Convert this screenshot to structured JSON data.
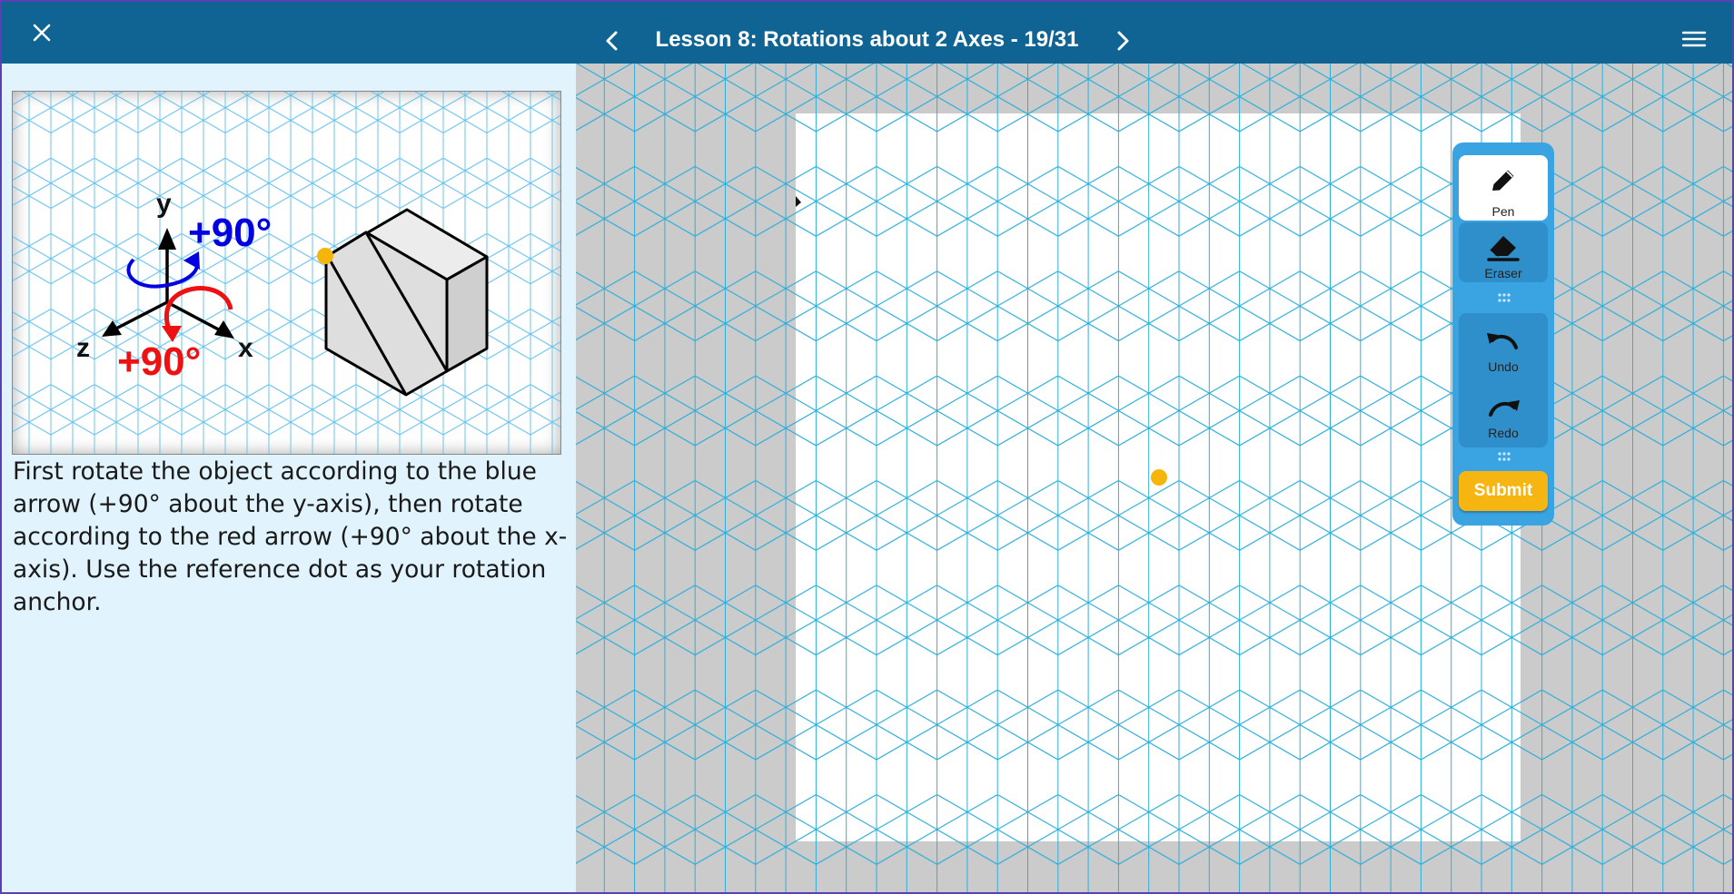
{
  "header": {
    "title": "Lesson 8: Rotations about 2 Axes - 19/31",
    "close_icon": "close-icon",
    "prev_icon": "chevron-left-icon",
    "next_icon": "chevron-right-icon",
    "menu_icon": "hamburger-menu-icon"
  },
  "figure": {
    "axis_labels": {
      "y": "y",
      "z": "z",
      "x": "x"
    },
    "blue_rotation_label": "+90°",
    "red_rotation_label": "+90°",
    "colors": {
      "blue": "#0000e0",
      "red": "#ee1111",
      "dot": "#f5b50a",
      "grid": "#6cc4ec"
    }
  },
  "instructions": "First rotate the object according to the blue arrow (+90° about the y-axis), then rotate according to the red arrow (+90° about the x-axis). Use the reference dot as your rotation anchor.",
  "toolbar": {
    "pen": {
      "label": "Pen",
      "icon": "pencil-icon"
    },
    "eraser": {
      "label": "Eraser",
      "icon": "eraser-icon"
    },
    "undo": {
      "label": "Undo",
      "icon": "undo-icon"
    },
    "redo": {
      "label": "Redo",
      "icon": "redo-icon"
    },
    "submit_label": "Submit"
  },
  "colors": {
    "header_bg": "#106493",
    "left_pane_bg": "#e1f3fd",
    "toolbar_bg": "#3aa4e3",
    "submit_bg": "#f6b510"
  }
}
